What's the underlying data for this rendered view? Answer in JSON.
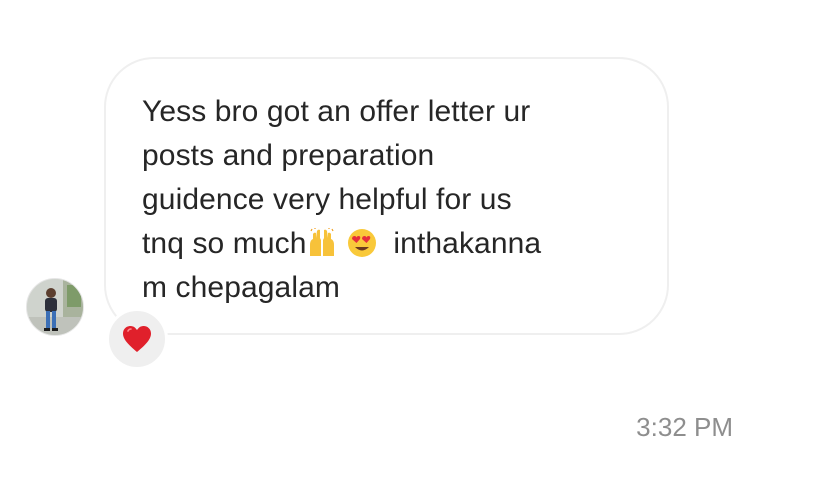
{
  "message": {
    "line1": "Yess bro got an offer letter ur",
    "line2": "posts and preparation",
    "line3": "guidence very helpful for us",
    "line4_before": "tnq so much",
    "line4_after": "  inthakanna",
    "line5": "m chepagalam",
    "emojis": [
      "raising-hands-icon",
      "heart-eyes-icon"
    ]
  },
  "reaction": {
    "icon": "red-heart-icon",
    "color": "#e0202b"
  },
  "timestamp": "3:32 PM",
  "colors": {
    "bubble_border": "#efefef",
    "text": "#262626",
    "muted": "#8e8e8e"
  }
}
